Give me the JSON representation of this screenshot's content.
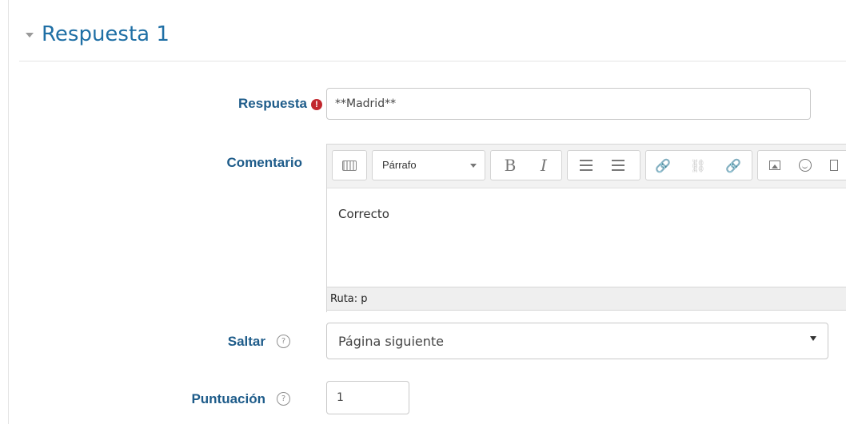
{
  "section": {
    "title": "Respuesta 1",
    "collapse_icon": "caret-down-icon"
  },
  "answer": {
    "label": "Respuesta",
    "required_icon": "!",
    "value": "**Madrid**"
  },
  "comment": {
    "label": "Comentario",
    "toolbar": {
      "format_value": "Párrafo",
      "bold": "B",
      "italic": "I",
      "link": "🔗",
      "unlink": "⛓"
    },
    "content": "Correcto",
    "path": "Ruta: p"
  },
  "jump": {
    "label": "Saltar",
    "help_icon": "?",
    "selected": "Página siguiente"
  },
  "score": {
    "label": "Puntuación",
    "help_icon": "?",
    "value": "1"
  }
}
